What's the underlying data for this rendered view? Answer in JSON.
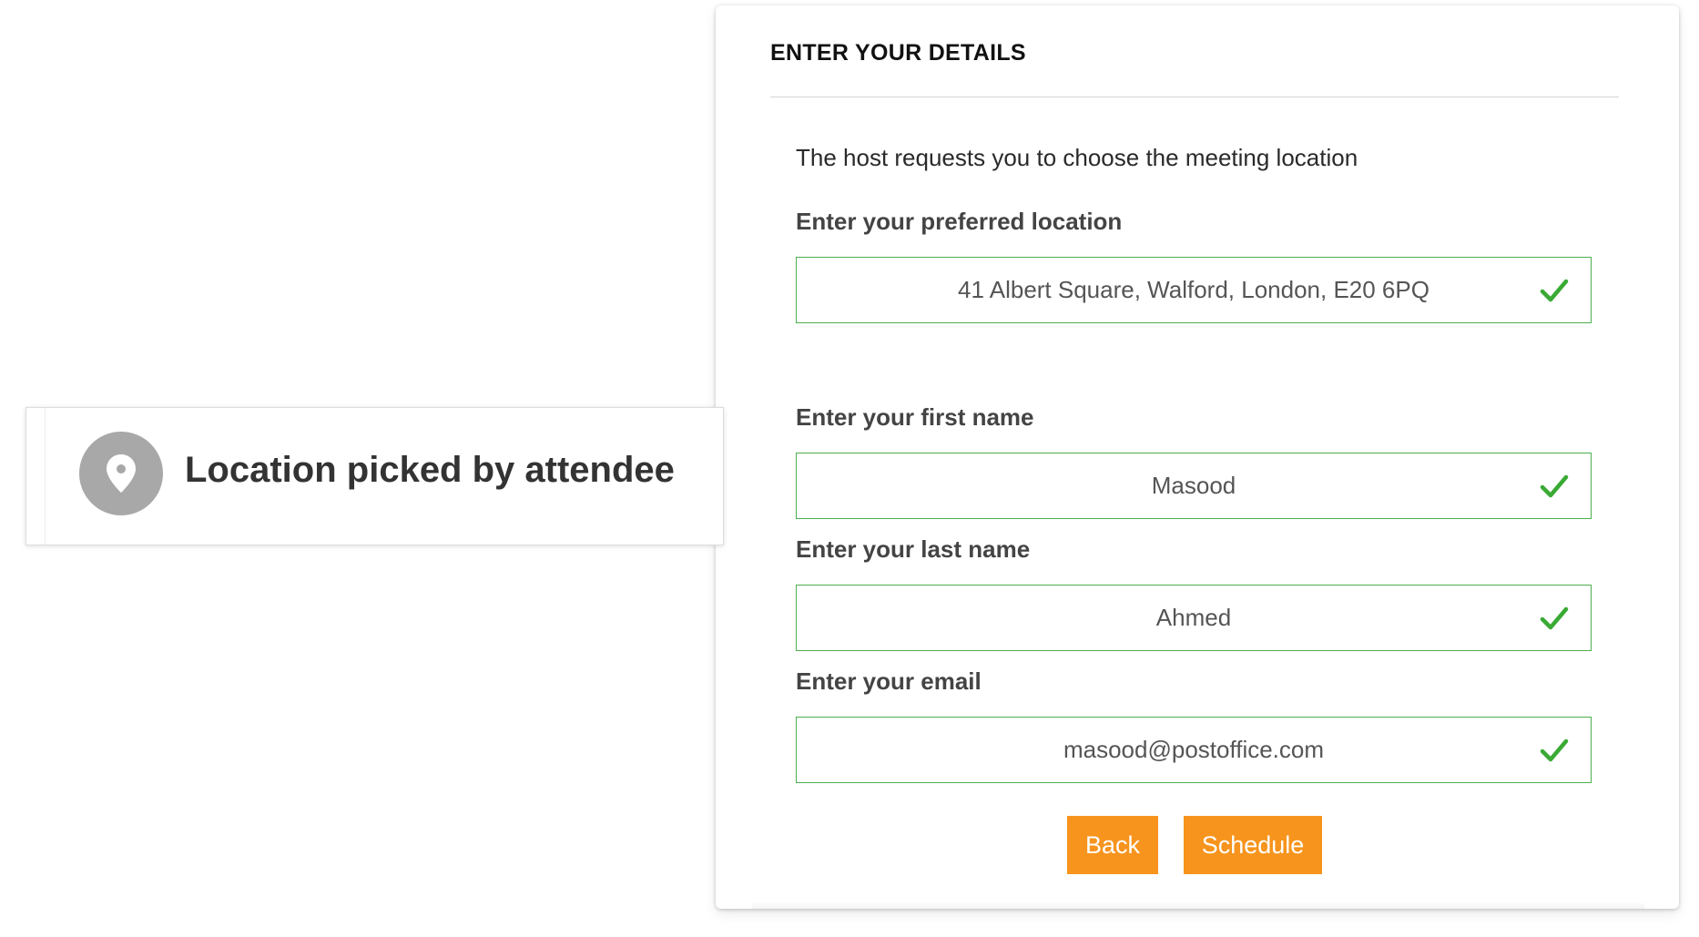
{
  "badge": {
    "text": "Location picked by attendee",
    "icon": "location-pin-icon",
    "icon_color": "#a8a8a8"
  },
  "form": {
    "title": "ENTER YOUR DETAILS",
    "intro": "The host requests you to choose the meeting location",
    "fields": [
      {
        "label": "Enter your preferred location",
        "value": "41 Albert Square, Walford, London, E20 6PQ",
        "valid": true
      },
      {
        "label": "Enter your first name",
        "value": "Masood",
        "valid": true
      },
      {
        "label": "Enter your last name",
        "value": "Ahmed",
        "valid": true
      },
      {
        "label": "Enter your email",
        "value": "masood@postoffice.com",
        "valid": true
      }
    ],
    "buttons": {
      "back": "Back",
      "schedule": "Schedule"
    }
  },
  "colors": {
    "accent": "#f7941d",
    "valid_border": "#4caf50",
    "check": "#3aaa35"
  }
}
